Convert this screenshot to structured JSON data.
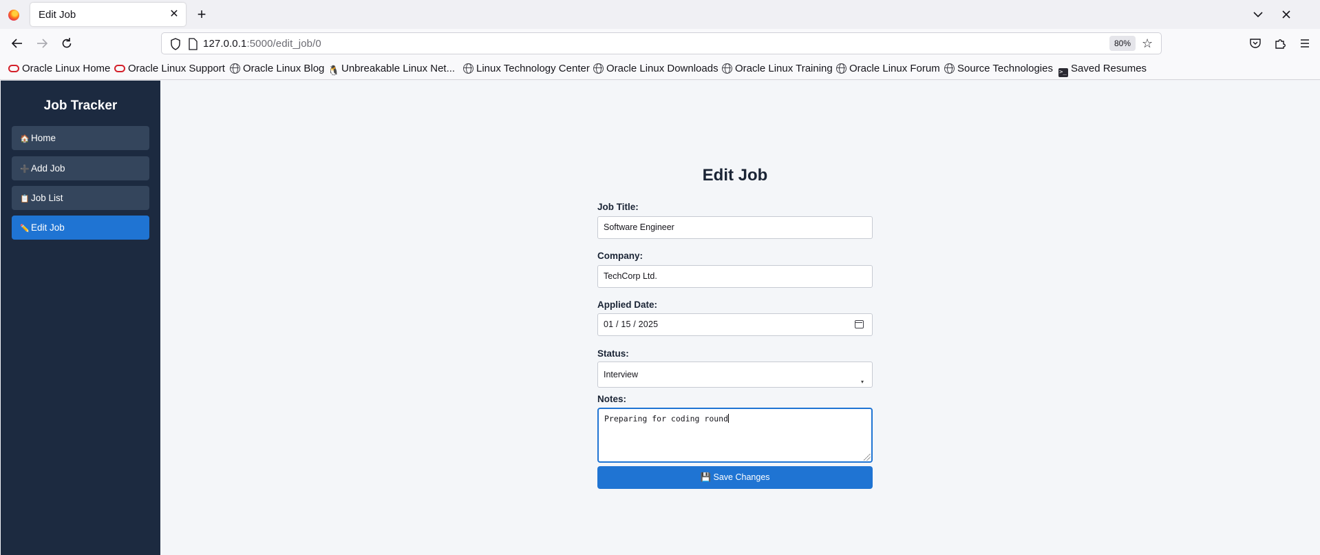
{
  "browser": {
    "tab_title": "Edit Job",
    "url_host": "127.0.0.1",
    "url_path": ":5000/edit_job/0",
    "zoom": "80%",
    "new_tab_glyph": "+",
    "close_tab_glyph": "✕",
    "bookmarks": [
      {
        "label": "Oracle Linux Home",
        "icon": "oracle-icon"
      },
      {
        "label": "Oracle Linux Support",
        "icon": "oracle-icon"
      },
      {
        "label": "Oracle Linux Blog",
        "icon": "globe-icon"
      },
      {
        "label": "Unbreakable Linux Net...",
        "icon": "tux-icon"
      },
      {
        "label": "Linux Technology Center",
        "icon": "globe-icon"
      },
      {
        "label": "Oracle Linux Downloads",
        "icon": "globe-icon"
      },
      {
        "label": "Oracle Linux Training",
        "icon": "globe-icon"
      },
      {
        "label": "Oracle Linux Forum",
        "icon": "globe-icon"
      },
      {
        "label": "Source Technologies",
        "icon": "globe-icon"
      },
      {
        "label": "Saved Resumes",
        "icon": "terminal-icon"
      }
    ]
  },
  "sidebar": {
    "title": "Job Tracker",
    "items": [
      {
        "icon": "🏠",
        "label": "Home",
        "active": false
      },
      {
        "icon": "➕",
        "label": "Add Job",
        "active": false
      },
      {
        "icon": "📋",
        "label": "Job List",
        "active": false
      },
      {
        "icon": "✏️",
        "label": "Edit Job",
        "active": true
      }
    ]
  },
  "form": {
    "heading": "Edit Job",
    "job_title_label": "Job Title:",
    "job_title_value": "Software Engineer",
    "company_label": "Company:",
    "company_value": "TechCorp Ltd.",
    "applied_date_label": "Applied Date:",
    "applied_date_value": "01 / 15 / 2025",
    "status_label": "Status:",
    "status_value": "Interview",
    "notes_label": "Notes:",
    "notes_value": "Preparing for coding round",
    "save_icon": "💾",
    "save_label": "Save Changes"
  },
  "colors": {
    "sidebar_bg": "#1c2a40",
    "sidebar_item_bg": "#34455c",
    "accent": "#1f74d3",
    "page_bg": "#f4f6f9"
  }
}
